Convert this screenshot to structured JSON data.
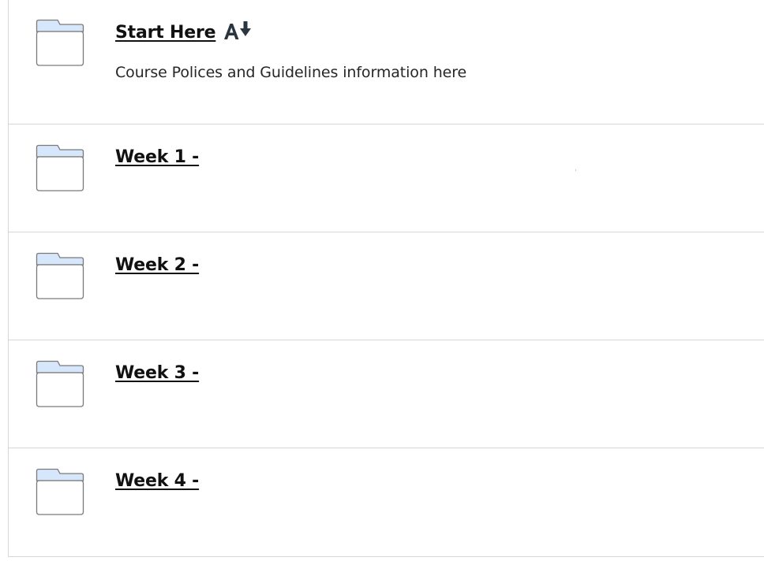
{
  "items": [
    {
      "title": "Start Here",
      "description": "Course Polices and Guidelines information here",
      "icon": "folder-icon",
      "badge_icon": "sort-alpha-down-icon"
    },
    {
      "title": "Week 1 -",
      "icon": "folder-icon"
    },
    {
      "title": "Week 2 -",
      "icon": "folder-icon"
    },
    {
      "title": "Week 3 -",
      "icon": "folder-icon"
    },
    {
      "title": "Week 4 -",
      "icon": "folder-icon"
    }
  ],
  "colors": {
    "folder_tab": "#d6e6fb",
    "folder_stroke": "#7a7a7a",
    "divider": "#d6d6d6",
    "title": "#111111"
  }
}
